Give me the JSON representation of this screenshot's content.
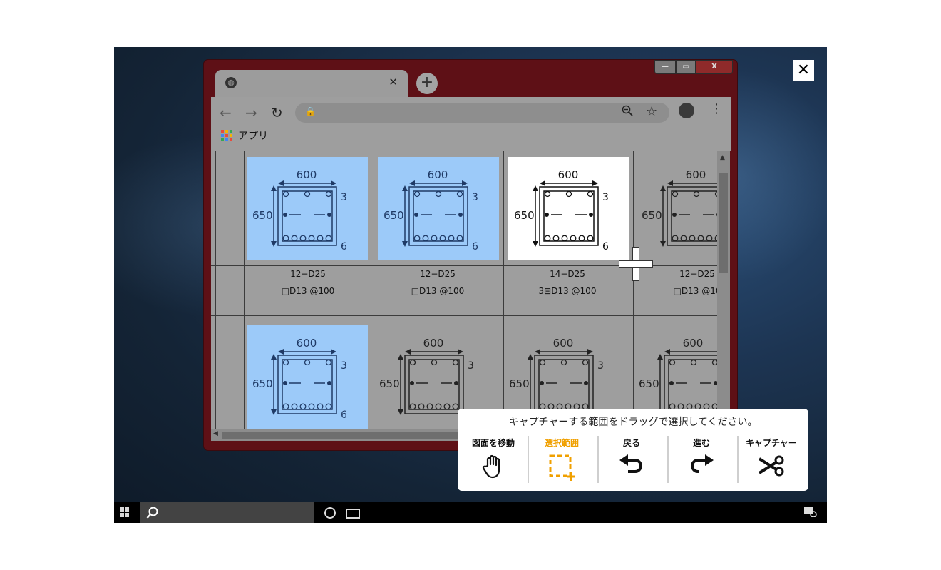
{
  "dialog": {
    "close_symbol": "✕"
  },
  "browser": {
    "window_controls": {
      "minimize": "—",
      "maximize": "▭",
      "close": "X"
    },
    "tab": {
      "close": "✕"
    },
    "new_tab": "+",
    "nav": {
      "back": "←",
      "forward": "→",
      "reload": "↻"
    },
    "bookmarks": {
      "apps_label": "アプリ",
      "apps_colors": [
        "#e84b3c",
        "#f6b400",
        "#34a853",
        "#4285f4",
        "#e84b3c",
        "#f6b400",
        "#34a853",
        "#4285f4",
        "#e84b3c"
      ]
    }
  },
  "drawing": {
    "width_label": "600",
    "height_label": "650",
    "top_bar_count": "3",
    "bottom_bar_count": "6",
    "row1_main": [
      "12−D25",
      "12−D25",
      "14−D25",
      "12−D25"
    ],
    "row1_hoop": [
      "□D13 @100",
      "□D13 @100",
      "3⊟D13 @100",
      "□D13 @10"
    ],
    "highlight_color": "#9ccaf9"
  },
  "capture": {
    "instruction": "キャプチャーする範囲をドラッグで選択してください。",
    "tools": [
      {
        "label": "図面を移動",
        "icon": "hand-icon"
      },
      {
        "label": "選択範囲",
        "icon": "selection-icon",
        "active": true
      },
      {
        "label": "戻る",
        "icon": "undo-icon"
      },
      {
        "label": "進む",
        "icon": "redo-icon"
      },
      {
        "label": "キャプチャー",
        "icon": "scissors-icon"
      }
    ],
    "active_color": "#f0a000"
  }
}
